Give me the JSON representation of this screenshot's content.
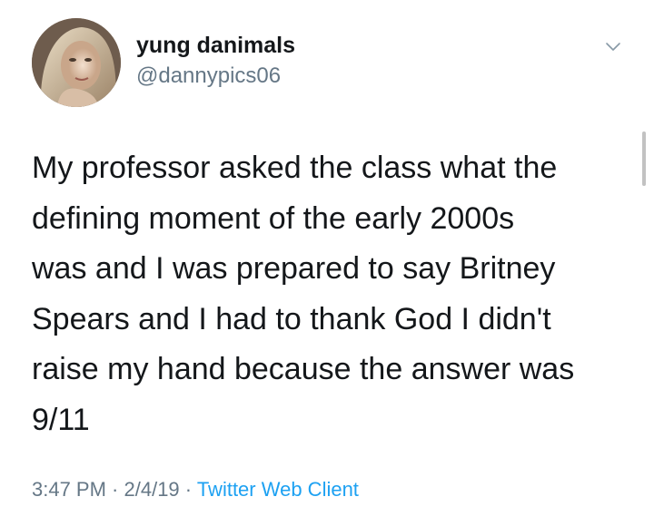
{
  "user": {
    "display_name": "yung danimals",
    "handle": "@dannypics06"
  },
  "tweet": {
    "lines": [
      "My professor asked the class what the",
      "defining moment of the early 2000s",
      "was and I was prepared to say Britney",
      "Spears and I had to thank God I didn't",
      "raise my hand because the answer was",
      "9/11"
    ],
    "time": "3:47 PM",
    "separator": " · ",
    "date": "2/4/19",
    "source": "Twitter Web Client"
  },
  "icons": {
    "menu": "chevron-down-icon"
  },
  "colors": {
    "text": "#14171a",
    "secondary": "#657786",
    "link": "#1da1f2",
    "background": "#ffffff"
  }
}
